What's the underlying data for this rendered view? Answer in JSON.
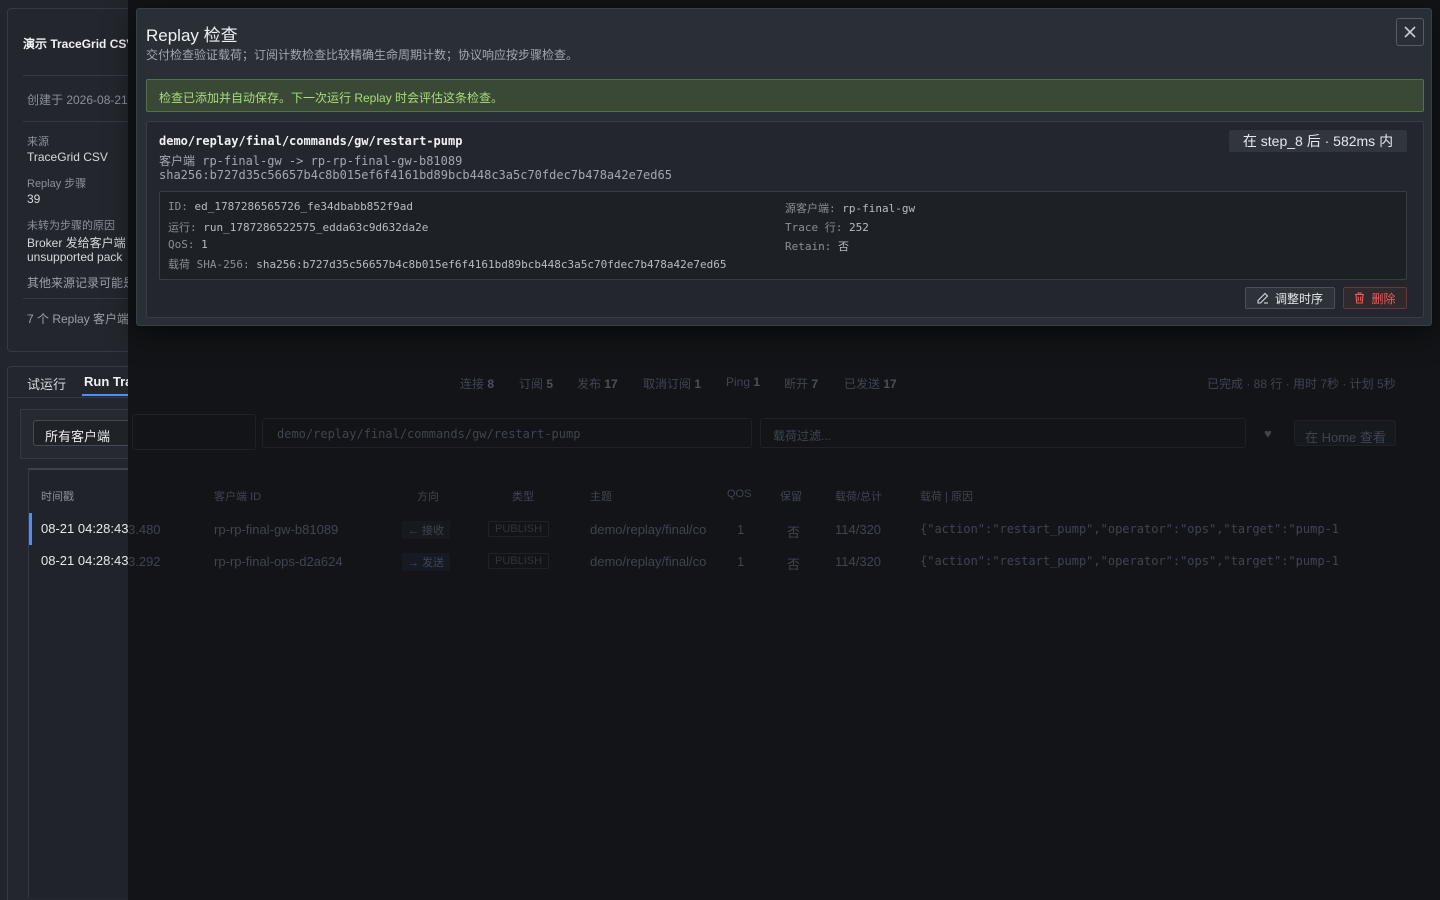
{
  "project": {
    "title": "演示 TraceGrid CSV",
    "created": "创建于 2026-08-21",
    "source_label": "来源",
    "source_value": "TraceGrid CSV",
    "steps_label": "Replay 步骤",
    "steps_value": "39",
    "unconverted_label": "未转为步骤的原因",
    "unconverted_line1": "Broker 发给客户端",
    "unconverted_line2": "unsupported pack",
    "other_note": "其他来源记录可能是",
    "clients_note": "7 个 Replay 客户端"
  },
  "tabs": {
    "trial": "试运行",
    "run_trace": "Run Trace"
  },
  "summary": {
    "connect_label": "连接",
    "connect": "8",
    "subscribe_label": "订阅",
    "subscribe": "5",
    "publish_label": "发布",
    "publish": "17",
    "unsubscribe_label": "取消订阅",
    "unsubscribe": "1",
    "ping_label": "Ping",
    "ping": "1",
    "disconnect_label": "断开",
    "disconnect": "7",
    "sent_label": "已发送",
    "sent": "17",
    "status": "已完成 · 88 行 · 用时 7秒 · 计划 5秒"
  },
  "filters": {
    "client_select": "所有客户端",
    "topic_filter": "demo/replay/final/commands/gw/restart-pump",
    "payload_placeholder": "载荷过滤...",
    "home_button": "在 Home 查看"
  },
  "table": {
    "headers": [
      "时间戳",
      "客户端 ID",
      "方向",
      "类型",
      "主题",
      "QOS",
      "保留",
      "载荷/总计",
      "载荷 | 原因"
    ],
    "rows": [
      {
        "time": "08-21 04:28:43.480",
        "client": "rp-rp-final-gw-b81089",
        "direction": "← 接收",
        "type": "PUBLISH",
        "topic": "demo/replay/final/co",
        "qos": "1",
        "retain": "否",
        "size": "114/320",
        "payload": "{\"action\":\"restart_pump\",\"operator\":\"ops\",\"target\":\"pump-1"
      },
      {
        "time": "08-21 04:28:43.292",
        "client": "rp-rp-final-ops-d2a624",
        "direction": "→ 发送",
        "type": "PUBLISH",
        "topic": "demo/replay/final/co",
        "qos": "1",
        "retain": "否",
        "size": "114/320",
        "payload": "{\"action\":\"restart_pump\",\"operator\":\"ops\",\"target\":\"pump-1"
      }
    ]
  },
  "modal": {
    "title": "Replay 检查",
    "subtitle": "交付检查验证载荷；订阅计数检查比较精确生命周期计数；协议响应按步骤检查。",
    "success_message": "检查已添加并自动保存。下一次运行 Replay 时会评估这条检查。",
    "check": {
      "topic": "demo/replay/final/commands/gw/restart-pump",
      "client_line": "客户端 rp-final-gw -> rp-rp-final-gw-b81089",
      "hash_line": "sha256:b727d35c56657b4c8b015ef6f4161bd89bcb448c3a5c70fdec7b478a42e7ed65",
      "timing": "在 step_8 后 · 582ms 内",
      "id_label": "ID:",
      "id_value": "ed_1787286565726_fe34dbabb852f9ad",
      "run_label": "运行:",
      "run_value": "run_1787286522575_edda63c9d632da2e",
      "qos_label": "QoS:",
      "qos_value": "1",
      "payload_sha_label": "载荷 SHA-256:",
      "payload_sha_value": "sha256:b727d35c56657b4c8b015ef6f4161bd89bcb448c3a5c70fdec7b478a42e7ed65",
      "source_client_label": "源客户端:",
      "source_client_value": "rp-final-gw",
      "trace_row_label": "Trace 行:",
      "trace_row_value": "252",
      "retain_label": "Retain:",
      "retain_value": "否"
    },
    "adjust_button": "调整时序",
    "delete_button": "删除"
  },
  "colors": {
    "accent": "#4c8dff",
    "success_text": "#a7dd7a",
    "danger": "#ef5b5b"
  }
}
